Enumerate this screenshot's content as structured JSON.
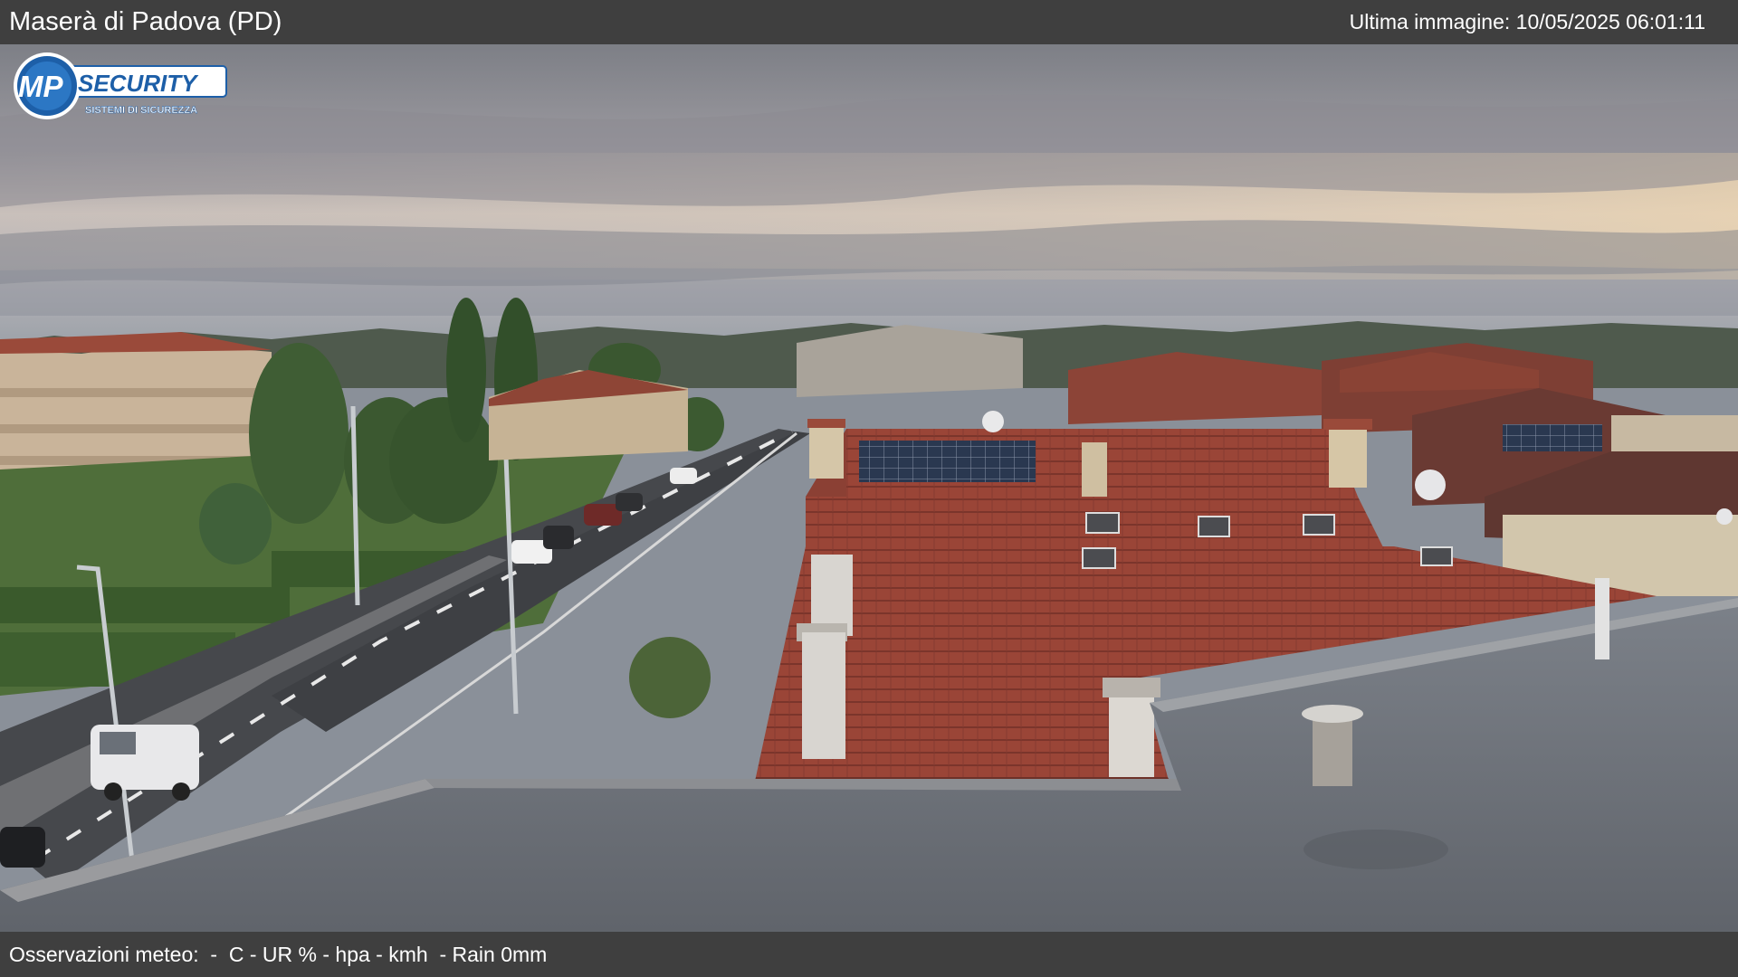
{
  "header": {
    "location_title": "Maserà di Padova (PD)",
    "last_image_label": "Ultima immagine: 10/05/2025 06:01:11"
  },
  "logo": {
    "brand_mp": "MP",
    "brand_security": "SECURITY",
    "tagline": "SISTEMI DI SICUREZZA"
  },
  "footer": {
    "weather_text": "Osservazioni meteo:  -  C - UR % - hpa - kmh  - Rain 0mm"
  },
  "colors": {
    "bar_background": "#3f3f3f",
    "bar_text": "#ffffff",
    "roof_tile": "#a2493a",
    "logo_blue": "#1d5fa8"
  }
}
